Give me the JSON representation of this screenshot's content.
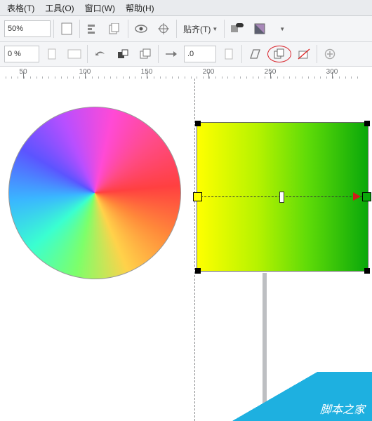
{
  "menus": {
    "tables": "表格(T)",
    "tools": "工具(O)",
    "windows": "窗口(W)",
    "help": "帮助(H)"
  },
  "tb1": {
    "zoom": "50%",
    "snap": "贴齐(T)"
  },
  "tb2": {
    "pct": "0 %",
    "val": ".0"
  },
  "ruler": {
    "ticks": [
      50,
      100,
      150,
      200,
      250,
      300
    ]
  },
  "footer": {
    "text": "脚本之家"
  }
}
